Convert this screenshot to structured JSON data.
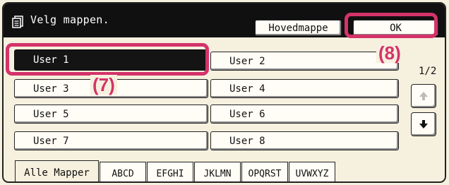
{
  "header": {
    "title": "Velg mappen.",
    "icon": "folder-list-icon",
    "home_label": "Hovedmappe",
    "ok_label": "OK"
  },
  "users": [
    "User 1",
    "User 2",
    "User 3",
    "User 4",
    "User 5",
    "User 6",
    "User 7",
    "User 8"
  ],
  "selected_user": "User 1",
  "pagination": {
    "text": "1/2"
  },
  "tabs": [
    "Alle Mapper",
    "ABCD",
    "EFGHI",
    "JKLMN",
    "OPQRST",
    "UVWXYZ"
  ],
  "active_tab": "Alle Mapper",
  "callouts": {
    "left": "(7)",
    "right": "(8)"
  },
  "colors": {
    "highlight": "#d4336a",
    "header_bg": "#101010",
    "panel_bg": "#f6f0de"
  }
}
